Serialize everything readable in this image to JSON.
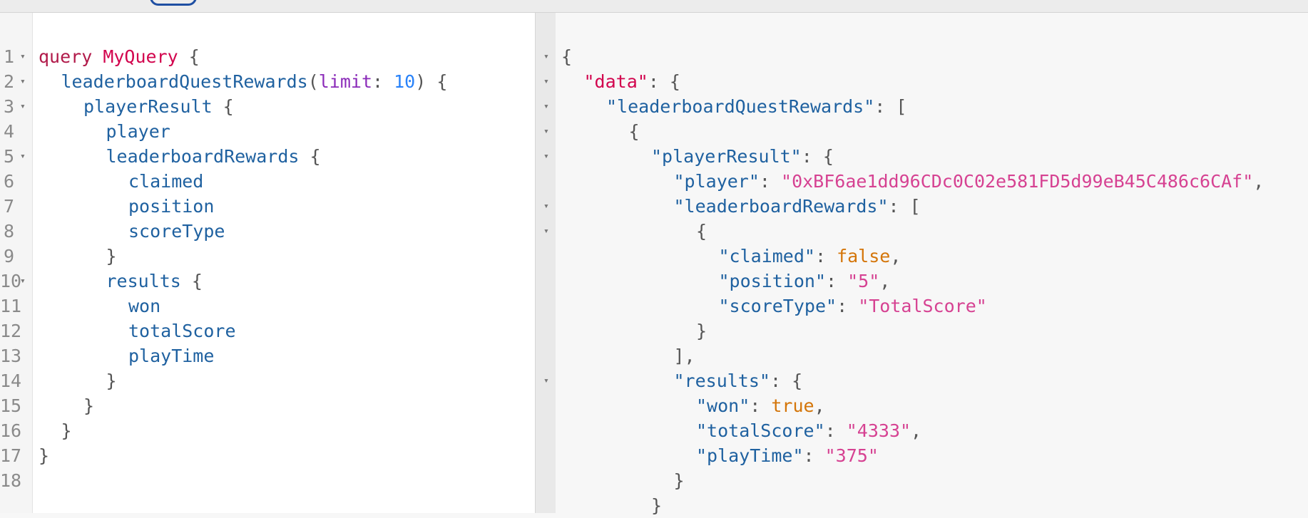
{
  "query": {
    "lines": [
      {
        "n": "1",
        "fold": true,
        "indent": 0,
        "toks": [
          [
            "kw",
            "query"
          ],
          [
            "p",
            " "
          ],
          [
            "def",
            "MyQuery"
          ],
          [
            "p",
            " {"
          ]
        ]
      },
      {
        "n": "2",
        "fold": true,
        "indent": 1,
        "toks": [
          [
            "f",
            "leaderboardQuestRewards"
          ],
          [
            "p",
            "("
          ],
          [
            "arg",
            "limit"
          ],
          [
            "p",
            ": "
          ],
          [
            "num",
            "10"
          ],
          [
            "p",
            ") {"
          ]
        ]
      },
      {
        "n": "3",
        "fold": true,
        "indent": 2,
        "toks": [
          [
            "f",
            "playerResult"
          ],
          [
            "p",
            " {"
          ]
        ]
      },
      {
        "n": "4",
        "fold": false,
        "indent": 3,
        "toks": [
          [
            "f",
            "player"
          ]
        ]
      },
      {
        "n": "5",
        "fold": true,
        "indent": 3,
        "toks": [
          [
            "f",
            "leaderboardRewards"
          ],
          [
            "p",
            " {"
          ]
        ]
      },
      {
        "n": "6",
        "fold": false,
        "indent": 4,
        "toks": [
          [
            "f",
            "claimed"
          ]
        ]
      },
      {
        "n": "7",
        "fold": false,
        "indent": 4,
        "toks": [
          [
            "f",
            "position"
          ]
        ]
      },
      {
        "n": "8",
        "fold": false,
        "indent": 4,
        "toks": [
          [
            "f",
            "scoreType"
          ]
        ]
      },
      {
        "n": "9",
        "fold": false,
        "indent": 3,
        "toks": [
          [
            "p",
            "}"
          ]
        ]
      },
      {
        "n": "10",
        "fold": true,
        "indent": 3,
        "toks": [
          [
            "f",
            "results"
          ],
          [
            "p",
            " {"
          ]
        ]
      },
      {
        "n": "11",
        "fold": false,
        "indent": 4,
        "toks": [
          [
            "f",
            "won"
          ]
        ]
      },
      {
        "n": "12",
        "fold": false,
        "indent": 4,
        "toks": [
          [
            "f",
            "totalScore"
          ]
        ]
      },
      {
        "n": "13",
        "fold": false,
        "indent": 4,
        "toks": [
          [
            "f",
            "playTime"
          ]
        ]
      },
      {
        "n": "14",
        "fold": false,
        "indent": 3,
        "toks": [
          [
            "p",
            "}"
          ]
        ]
      },
      {
        "n": "15",
        "fold": false,
        "indent": 2,
        "toks": [
          [
            "p",
            "}"
          ]
        ]
      },
      {
        "n": "16",
        "fold": false,
        "indent": 1,
        "toks": [
          [
            "p",
            "}"
          ]
        ]
      },
      {
        "n": "17",
        "fold": false,
        "indent": 0,
        "toks": [
          [
            "p",
            "}"
          ]
        ]
      },
      {
        "n": "18",
        "fold": false,
        "indent": 0,
        "toks": []
      }
    ]
  },
  "result": {
    "lines": [
      {
        "fold": true,
        "indent": 0,
        "toks": [
          [
            "p",
            "{"
          ]
        ]
      },
      {
        "fold": true,
        "indent": 1,
        "toks": [
          [
            "def",
            "\"data\""
          ],
          [
            "p",
            ": {"
          ]
        ]
      },
      {
        "fold": true,
        "indent": 2,
        "toks": [
          [
            "k",
            "\"leaderboardQuestRewards\""
          ],
          [
            "p",
            ": ["
          ]
        ]
      },
      {
        "fold": true,
        "indent": 3,
        "toks": [
          [
            "p",
            "{"
          ]
        ]
      },
      {
        "fold": true,
        "indent": 4,
        "toks": [
          [
            "k",
            "\"playerResult\""
          ],
          [
            "p",
            ": {"
          ]
        ]
      },
      {
        "fold": false,
        "indent": 5,
        "toks": [
          [
            "k",
            "\"player\""
          ],
          [
            "p",
            ": "
          ],
          [
            "s",
            "\"0xBF6ae1dd96CDc0C02e581FD5d99eB45C486c6CAf\""
          ],
          [
            "p",
            ","
          ]
        ]
      },
      {
        "fold": true,
        "indent": 5,
        "toks": [
          [
            "k",
            "\"leaderboardRewards\""
          ],
          [
            "p",
            ": ["
          ]
        ]
      },
      {
        "fold": true,
        "indent": 6,
        "toks": [
          [
            "p",
            "{"
          ]
        ]
      },
      {
        "fold": false,
        "indent": 7,
        "toks": [
          [
            "k",
            "\"claimed\""
          ],
          [
            "p",
            ": "
          ],
          [
            "b",
            "false"
          ],
          [
            "p",
            ","
          ]
        ]
      },
      {
        "fold": false,
        "indent": 7,
        "toks": [
          [
            "k",
            "\"position\""
          ],
          [
            "p",
            ": "
          ],
          [
            "s",
            "\"5\""
          ],
          [
            "p",
            ","
          ]
        ]
      },
      {
        "fold": false,
        "indent": 7,
        "toks": [
          [
            "k",
            "\"scoreType\""
          ],
          [
            "p",
            ": "
          ],
          [
            "s",
            "\"TotalScore\""
          ]
        ]
      },
      {
        "fold": false,
        "indent": 6,
        "toks": [
          [
            "p",
            "}"
          ]
        ]
      },
      {
        "fold": false,
        "indent": 5,
        "toks": [
          [
            "p",
            "],"
          ]
        ]
      },
      {
        "fold": true,
        "indent": 5,
        "toks": [
          [
            "k",
            "\"results\""
          ],
          [
            "p",
            ": {"
          ]
        ]
      },
      {
        "fold": false,
        "indent": 6,
        "toks": [
          [
            "k",
            "\"won\""
          ],
          [
            "p",
            ": "
          ],
          [
            "b",
            "true"
          ],
          [
            "p",
            ","
          ]
        ]
      },
      {
        "fold": false,
        "indent": 6,
        "toks": [
          [
            "k",
            "\"totalScore\""
          ],
          [
            "p",
            ": "
          ],
          [
            "s",
            "\"4333\""
          ],
          [
            "p",
            ","
          ]
        ]
      },
      {
        "fold": false,
        "indent": 6,
        "toks": [
          [
            "k",
            "\"playTime\""
          ],
          [
            "p",
            ": "
          ],
          [
            "s",
            "\"375\""
          ]
        ]
      },
      {
        "fold": false,
        "indent": 5,
        "toks": [
          [
            "p",
            "}"
          ]
        ]
      },
      {
        "fold": false,
        "indent": 4,
        "toks": [
          [
            "p",
            "}"
          ]
        ]
      }
    ]
  },
  "colors": {
    "keyword": "#b11a4a",
    "definition": "#d2054e",
    "field": "#1f61a0",
    "argument": "#8b2bb9",
    "number": "#2882f9",
    "string": "#d64292",
    "boolean": "#d47509",
    "punctuation": "#555555"
  }
}
